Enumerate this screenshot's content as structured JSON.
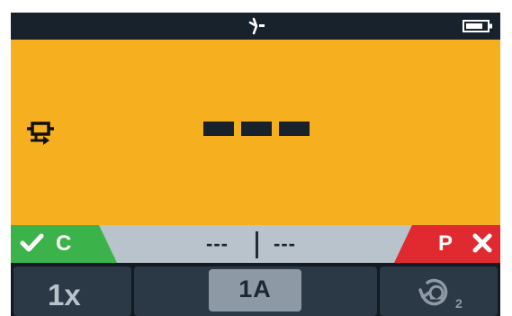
{
  "topbar": {
    "connection_icon": "plug-icon",
    "battery_icon": "battery-icon"
  },
  "reading": {
    "mode_icon": "continuity-probe-icon",
    "main_value": "---"
  },
  "status": {
    "pass_label": "C",
    "fail_label": "P",
    "left_value": "---",
    "right_value": "---",
    "pass_color": "#3cb34a",
    "fail_color": "#e02a2f"
  },
  "softkeys": {
    "left_label": "1x",
    "middle_label": "1A",
    "right_icon": "reverse-ohm-icon",
    "right_subscript": "2"
  },
  "colors": {
    "background": "#f6b01f",
    "dark": "#17222d",
    "strip": "#b9c3cc"
  }
}
